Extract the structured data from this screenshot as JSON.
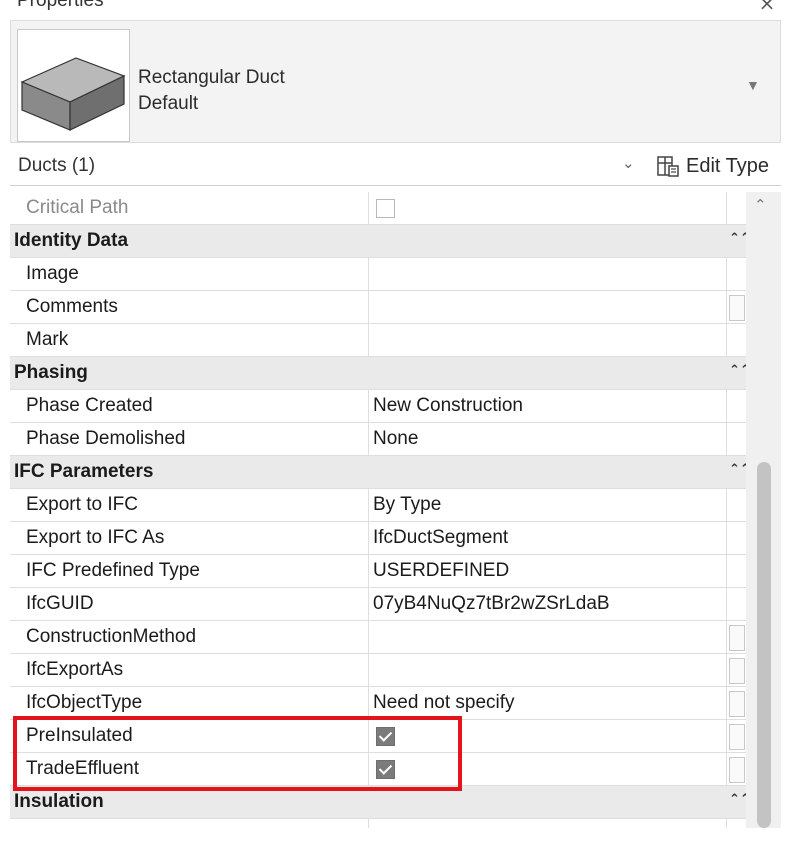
{
  "panel": {
    "title": "Properties",
    "close_glyph": "⨯"
  },
  "type_selector": {
    "name": "Rectangular Duct",
    "type": "Default",
    "thumbnail_icon": "rectangular-duct-thumbnail"
  },
  "instance_selector": {
    "label": "Ducts (1)",
    "edit_type_label": "Edit Type",
    "edit_type_icon": "edit-type-icon"
  },
  "properties": {
    "critical_path": {
      "label": "Critical Path",
      "checked": false
    },
    "identity_data": {
      "title": "Identity Data",
      "rows": [
        {
          "label": "Image",
          "value": ""
        },
        {
          "label": "Comments",
          "value": ""
        },
        {
          "label": "Mark",
          "value": ""
        }
      ]
    },
    "phasing": {
      "title": "Phasing",
      "rows": [
        {
          "label": "Phase Created",
          "value": "New Construction"
        },
        {
          "label": "Phase Demolished",
          "value": "None"
        }
      ]
    },
    "ifc_parameters": {
      "title": "IFC Parameters",
      "rows": [
        {
          "label": "Export to IFC",
          "value": "By Type"
        },
        {
          "label": "Export to IFC As",
          "value": "IfcDuctSegment"
        },
        {
          "label": "IFC Predefined Type",
          "value": "USERDEFINED"
        },
        {
          "label": "IfcGUID",
          "value": "07yB4NuQz7tBr2wZSrLdaB"
        },
        {
          "label": "ConstructionMethod",
          "value": ""
        },
        {
          "label": "IfcExportAs",
          "value": ""
        },
        {
          "label": "IfcObjectType",
          "value": "Need not specify"
        },
        {
          "label": "PreInsulated",
          "checked": true
        },
        {
          "label": "TradeEffluent",
          "checked": true
        }
      ]
    },
    "insulation": {
      "title": "Insulation"
    }
  },
  "annotation": {
    "color": "#e1151b"
  }
}
